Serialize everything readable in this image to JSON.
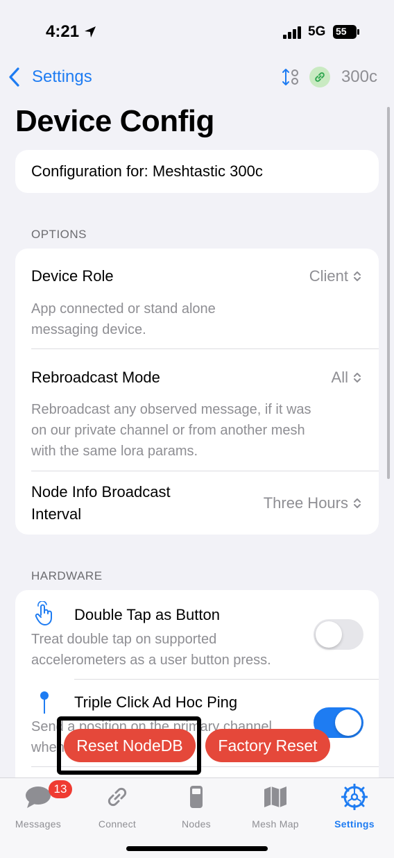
{
  "status_bar": {
    "time": "4:21",
    "network": "5G",
    "battery": "55"
  },
  "nav": {
    "back_label": "Settings",
    "device_short": "300c"
  },
  "page_title": "Device Config",
  "config_for": "Configuration for: Meshtastic 300c",
  "options": {
    "header": "OPTIONS",
    "device_role": {
      "label": "Device Role",
      "value": "Client",
      "description_line1": "App connected or stand alone",
      "description_line2": "messaging device."
    },
    "rebroadcast_mode": {
      "label": "Rebroadcast Mode",
      "value": "All",
      "description_line1": "Rebroadcast any observed message, if it was",
      "description_line2": "on our private channel or from another mesh",
      "description_line3": "with the same lora params."
    },
    "node_info_interval": {
      "label_line1": "Node Info Broadcast",
      "label_line2": "Interval",
      "value": "Three Hours"
    }
  },
  "hardware": {
    "header": "HARDWARE",
    "double_tap": {
      "label": "Double Tap as Button",
      "description_line1": "Treat double tap on supported",
      "description_line2": "accelerometers as a user button press.",
      "enabled": false
    },
    "triple_click": {
      "label": "Triple Click Ad Hoc Ping",
      "description_line1": "Send a position on the primary channel",
      "description_line2": "when",
      "enabled": true
    }
  },
  "actions": {
    "reset_nodedb": "Reset NodeDB",
    "factory_reset": "Factory Reset"
  },
  "tabs": [
    {
      "label": "Messages",
      "icon": "chat-bubble-icon"
    },
    {
      "label": "Connect",
      "icon": "link-icon"
    },
    {
      "label": "Nodes",
      "icon": "radio-device-icon"
    },
    {
      "label": "Mesh Map",
      "icon": "map-icon"
    },
    {
      "label": "Settings",
      "icon": "gear-icon"
    }
  ],
  "messages_badge": "13",
  "colors": {
    "accent": "#1e7cf2",
    "destructive": "#e5483a",
    "badge": "#ef3b32",
    "background": "#f2f2f7"
  }
}
